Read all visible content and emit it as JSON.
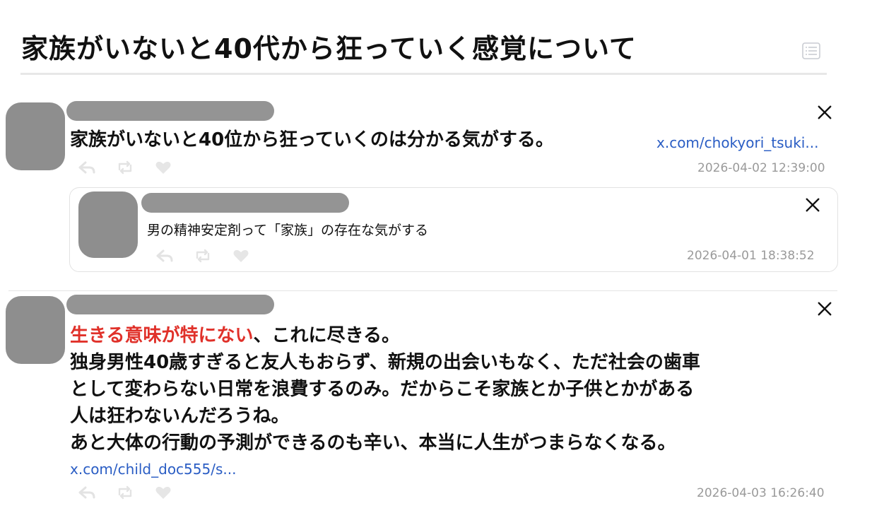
{
  "page": {
    "title": "家族がいないと40代から狂っていく感覚について",
    "toc_icon": "list-icon"
  },
  "posts": [
    {
      "text": "家族がいないと40位から狂っていくのは分かる気がする。",
      "link": "x.com/chokyori_tsuki...",
      "date": "2026-04-02 12:39:00",
      "platform_icon": "x-logo-icon",
      "quote": {
        "text": "男の精神安定剤って「家族」の存在な気がする",
        "date": "2026-04-01 18:38:52",
        "platform_icon": "x-logo-icon"
      }
    },
    {
      "highlight": "生きる意味が特にない",
      "lead_rest": "、これに尽きる。",
      "lines": [
        "独身男性40歳すぎると友人もおらず、新規の出会いもなく、ただ社会の歯車",
        "として変わらない日常を浪費するのみ。だからこそ家族とか子供とかがある",
        "人は狂わないんだろうね。",
        "あと大体の行動の予測ができるのも辛い、本当に人生がつまらなくなる。"
      ],
      "link": "x.com/child_doc555/s...",
      "date": "2026-04-03 16:26:40",
      "platform_icon": "x-logo-icon"
    }
  ],
  "colors": {
    "highlight": "#e0312a",
    "link": "#2a5dc4",
    "muted": "#9a9a9a",
    "redacted": "#8e8e8e"
  }
}
